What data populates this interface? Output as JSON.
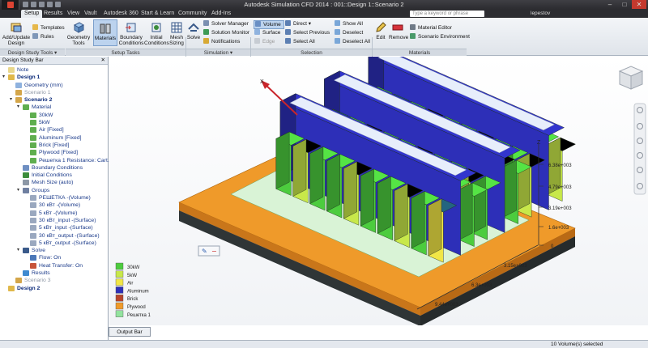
{
  "title_bar": {
    "title": "Autodesk Simulation CFD 2014 : 001::Design 1::Scenario 2",
    "minimize": "–",
    "maximize": "□",
    "close": "✕"
  },
  "tabs": [
    "Setup",
    "Results",
    "View",
    "Vault",
    "Autodesk 360",
    "Start & Learn",
    "Community",
    "Add-Ins"
  ],
  "search": {
    "placeholder": "Type a keyword or phrase"
  },
  "user": {
    "name": "lepestov"
  },
  "ribbon": {
    "add_update_design": "Add/Update Design",
    "templates": "Templates",
    "rules": "Rules",
    "geometry_tools": "Geometry Tools",
    "materials": "Materials",
    "boundary_conditions": "Boundary Conditions",
    "initial_conditions": "Initial Conditions",
    "mesh_sizing": "Mesh Sizing",
    "solve": "Solve",
    "solver_manager": "Solver Manager",
    "solution_monitor": "Solution Monitor",
    "notifications": "Notifications",
    "volume": "Volume",
    "surface": "Surface",
    "edge": "Edge",
    "direct": "Direct",
    "select_previous": "Select Previous",
    "select_all": "Select All",
    "show_all": "Show All",
    "deselect": "Deselect",
    "deselect_all": "Deselect All",
    "edit": "Edit",
    "remove": "Remove",
    "material_editor": "Material Editor",
    "scenario_environment": "Scenario Environment",
    "panels": {
      "design_study_tools": "Design Study Tools ▾",
      "setup_tasks": "Setup Tasks",
      "simulation": "Simulation ▾",
      "selection": "Selection",
      "materials": "Materials"
    }
  },
  "sidebar": {
    "title": "Design Study Bar",
    "close": "✕",
    "tree": [
      {
        "label": "Note",
        "level": 0,
        "icon": "note-icon",
        "style": ""
      },
      {
        "label": "Design 1",
        "level": 0,
        "icon": "design-icon",
        "style": "bold",
        "expanded": true
      },
      {
        "label": "Geometry (mm)",
        "level": 1,
        "icon": "geometry-icon",
        "style": ""
      },
      {
        "label": "Scenario 1",
        "level": 1,
        "icon": "scenario-icon",
        "style": "dim"
      },
      {
        "label": "Scenario 2",
        "level": 1,
        "icon": "scenario-icon",
        "style": "bold",
        "expanded": true
      },
      {
        "label": "Material",
        "level": 2,
        "icon": "material-icon",
        "style": "",
        "expanded": true
      },
      {
        "label": "30kW",
        "level": 3,
        "icon": "material-icon",
        "style": ""
      },
      {
        "label": "5kW",
        "level": 3,
        "icon": "material-icon",
        "style": ""
      },
      {
        "label": "Air [Fixed]",
        "level": 3,
        "icon": "material-icon",
        "style": ""
      },
      {
        "label": "Aluminum [Fixed]",
        "level": 3,
        "icon": "material-icon",
        "style": ""
      },
      {
        "label": "Brick [Fixed]",
        "level": 3,
        "icon": "material-icon",
        "style": ""
      },
      {
        "label": "Plywood [Fixed]",
        "level": 3,
        "icon": "material-icon",
        "style": ""
      },
      {
        "label": "Решетка 1 Resistance: Cart...",
        "level": 3,
        "icon": "material-icon",
        "style": ""
      },
      {
        "label": "Boundary Conditions",
        "level": 2,
        "icon": "boundary-icon",
        "style": ""
      },
      {
        "label": "Initial Conditions",
        "level": 2,
        "icon": "initial-icon",
        "style": ""
      },
      {
        "label": "Mesh Size (auto)",
        "level": 2,
        "icon": "mesh-icon",
        "style": ""
      },
      {
        "label": "Groups",
        "level": 2,
        "icon": "groups-icon",
        "style": "",
        "expanded": true
      },
      {
        "label": "РЕШЕТКА -(Volume)",
        "level": 3,
        "icon": "group-icon",
        "style": ""
      },
      {
        "label": "30 кВт -(Volume)",
        "level": 3,
        "icon": "group-icon",
        "style": ""
      },
      {
        "label": "5 кВт -(Volume)",
        "level": 3,
        "icon": "group-icon",
        "style": ""
      },
      {
        "label": "30 кВт_input -(Surface)",
        "level": 3,
        "icon": "group-icon",
        "style": ""
      },
      {
        "label": "5 кВт_input -(Surface)",
        "level": 3,
        "icon": "group-icon",
        "style": ""
      },
      {
        "label": "30 кВт_output -(Surface)",
        "level": 3,
        "icon": "group-icon",
        "style": ""
      },
      {
        "label": "5 кВт_output -(Surface)",
        "level": 3,
        "icon": "group-icon",
        "style": ""
      },
      {
        "label": "Solve",
        "level": 2,
        "icon": "solve-icon",
        "style": "",
        "expanded": true
      },
      {
        "label": "Flow: On",
        "level": 3,
        "icon": "flow-icon",
        "style": ""
      },
      {
        "label": "Heat Transfer: On",
        "level": 3,
        "icon": "heat-icon",
        "style": ""
      },
      {
        "label": "Results",
        "level": 2,
        "icon": "results-icon",
        "style": ""
      },
      {
        "label": "Scenario 3",
        "level": 1,
        "icon": "scenario-icon",
        "style": "dim"
      },
      {
        "label": "Design 2",
        "level": 0,
        "icon": "design-icon",
        "style": "bold"
      }
    ]
  },
  "legend": [
    {
      "label": "30kW",
      "color": "#4ccc3e"
    },
    {
      "label": "5kW",
      "color": "#c8e84a"
    },
    {
      "label": "Air",
      "color": "#f1e646"
    },
    {
      "label": "Aluminum",
      "color": "#2d2fb8"
    },
    {
      "label": "Brick",
      "color": "#b8442a"
    },
    {
      "label": "Plywood",
      "color": "#ef9a2a"
    },
    {
      "label": "Решетка 1",
      "color": "#93e39e"
    }
  ],
  "ruler": {
    "vertical": [
      "6.38e+003",
      "4.79e+003",
      "3.19e+003",
      "1.6e+003",
      "0"
    ],
    "horizontal": [
      "3.15e+003",
      "6.3e+003",
      "9.44e+003"
    ],
    "axis_z": "Z",
    "axis_x": "X"
  },
  "view_tools": {
    "edit": "✎",
    "minus": "−"
  },
  "output_bar": {
    "label": "Output Bar"
  },
  "status": {
    "text": "10 Volume(s) selected"
  },
  "colors": {
    "plywood": "#ef9a2a",
    "rack_green": "#4ccc3e",
    "rack_lime": "#c8e84a",
    "rack_yellow": "#f1e646",
    "aluminum_blue": "#2d2fb8",
    "grate": "#93e39e",
    "slab": "#3f4a4b",
    "arrow": "#c9252b"
  }
}
